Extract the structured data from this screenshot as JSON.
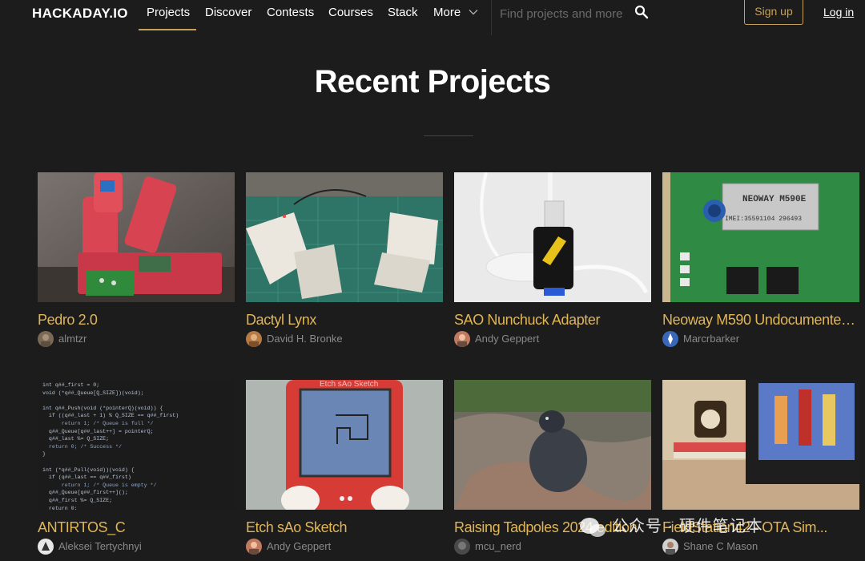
{
  "nav": {
    "logo": "HACKADAY.IO",
    "links": [
      "Projects",
      "Discover",
      "Contests",
      "Courses",
      "Stack",
      "More"
    ],
    "search_placeholder": "Find projects and more",
    "signup": "Sign up",
    "login": "Log in"
  },
  "heading": "Recent Projects",
  "projects": [
    {
      "title": "Pedro 2.0",
      "author": "almtzr"
    },
    {
      "title": "Dactyl Lynx",
      "author": "David H. Bronke"
    },
    {
      "title": "SAO Nunchuck Adapter",
      "author": "Andy Geppert"
    },
    {
      "title": "Neoway M590 Undocumented...",
      "author": "Marcrbarker"
    },
    {
      "title": "ANTIRTOS_C",
      "author": "Aleksei Tertychnyi"
    },
    {
      "title": "Etch sAo Sketch",
      "author": "Andy Geppert"
    },
    {
      "title": "Raising Tadpoles 2024 edition",
      "author": "mcu_nerd"
    },
    {
      "title": "FieldStation42 - OTA Sim...",
      "author": "Shane C Mason"
    }
  ],
  "thumb_text": {
    "neoway_model": "NEOWAY M590E",
    "neoway_imei": "IMEI:35591104 296493",
    "sketch_label": "Etch sAo Sketch"
  },
  "code_lines": [
    "int q##_first = 0;",
    "void (*q##_Queue[Q_SIZE])(void);",
    "",
    "int q##_Push(void (*pointerQ)(void)) {",
    "  if ((q##_last + 1) % Q_SIZE == q##_first)",
    "      return 1; /* Queue is full */",
    "  q##_Queue[q##_last++] = pointerQ;",
    "  q##_last %= Q_SIZE;",
    "  return 0; /* Success */",
    "}",
    "",
    "int (*q##_Pull(void))(void) {",
    "  if (q##_last == q##_first)",
    "      return 1; /* Queue is empty */",
    "  q##_Queue[q##_first++]();",
    "  q##_first %= Q_SIZE;",
    "  return 0;"
  ],
  "watermark": "公众号 · 硬件笔记本",
  "colors": {
    "accent": "#c5a15a",
    "project_title": "#e0b557",
    "background": "#1c1c1c"
  }
}
